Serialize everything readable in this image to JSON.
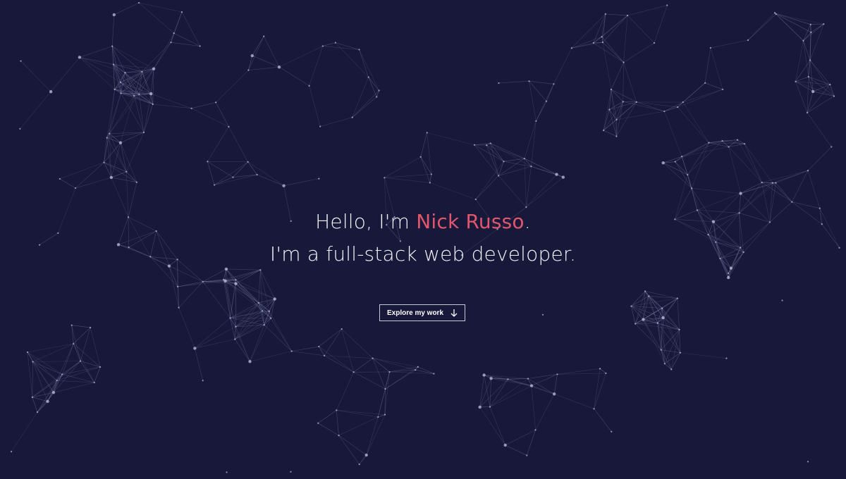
{
  "hero": {
    "greeting_prefix": "Hello, I'm ",
    "name": "Nick Russo",
    "greeting_suffix": ".",
    "tagline": "I'm a full-stack web developer.",
    "cta_label": "Explore my work",
    "cta_icon": "arrow-down-icon"
  },
  "colors": {
    "background": "#18193a",
    "accent": "#e2566c",
    "text": "#f3f3f7",
    "network_line": "#8c8fb8",
    "network_node": "#c8cae6"
  }
}
